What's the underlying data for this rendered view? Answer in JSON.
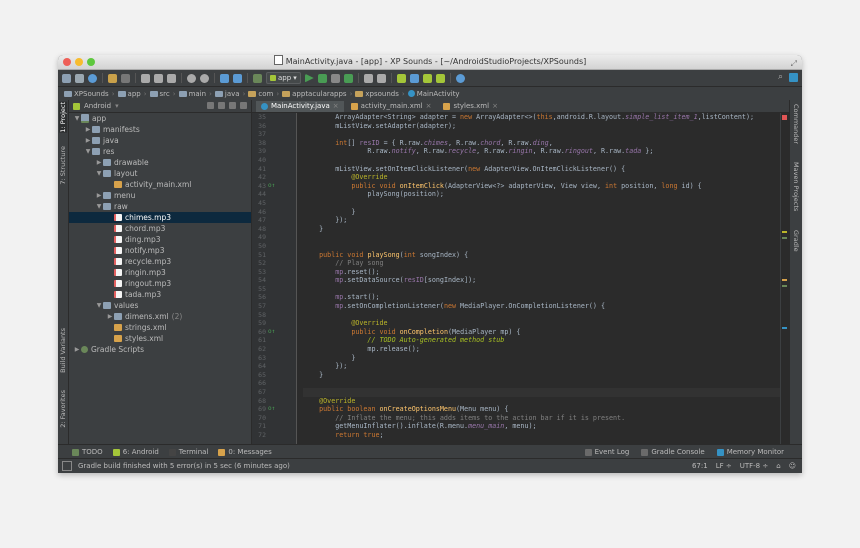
{
  "window": {
    "title": "MainActivity.java - [app] - XP Sounds - [~/AndroidStudioProjects/XPSounds]"
  },
  "toolbar": {
    "run_config": "app"
  },
  "breadcrumbs": [
    {
      "label": "XPSounds",
      "icon": "project-icon"
    },
    {
      "label": "app",
      "icon": "module-icon"
    },
    {
      "label": "src",
      "icon": "folder-icon"
    },
    {
      "label": "main",
      "icon": "folder-icon"
    },
    {
      "label": "java",
      "icon": "folder-icon"
    },
    {
      "label": "com",
      "icon": "package-icon"
    },
    {
      "label": "apptacularapps",
      "icon": "package-icon"
    },
    {
      "label": "xpsounds",
      "icon": "package-icon"
    },
    {
      "label": "MainActivity",
      "icon": "class-icon"
    }
  ],
  "left_tool_tabs": [
    "1: Project",
    "7: Structure",
    "Build Variants",
    "2: Favorites"
  ],
  "right_tool_tabs": [
    "Commander",
    "Maven Projects",
    "Gradle"
  ],
  "project": {
    "view_selector": "Android",
    "tree": [
      {
        "label": "app",
        "depth": 0,
        "icon": "module",
        "open": true
      },
      {
        "label": "manifests",
        "depth": 1,
        "icon": "folder",
        "open": false
      },
      {
        "label": "java",
        "depth": 1,
        "icon": "folder",
        "open": false
      },
      {
        "label": "res",
        "depth": 1,
        "icon": "folder",
        "open": true
      },
      {
        "label": "drawable",
        "depth": 2,
        "icon": "folder",
        "open": false
      },
      {
        "label": "layout",
        "depth": 2,
        "icon": "folder",
        "open": true
      },
      {
        "label": "activity_main.xml",
        "depth": 3,
        "icon": "xml"
      },
      {
        "label": "menu",
        "depth": 2,
        "icon": "folder",
        "open": false
      },
      {
        "label": "raw",
        "depth": 2,
        "icon": "folder",
        "open": true
      },
      {
        "label": "chimes.mp3",
        "depth": 3,
        "icon": "mp3",
        "selected": true
      },
      {
        "label": "chord.mp3",
        "depth": 3,
        "icon": "mp3"
      },
      {
        "label": "ding.mp3",
        "depth": 3,
        "icon": "mp3"
      },
      {
        "label": "notify.mp3",
        "depth": 3,
        "icon": "mp3"
      },
      {
        "label": "recycle.mp3",
        "depth": 3,
        "icon": "mp3"
      },
      {
        "label": "ringin.mp3",
        "depth": 3,
        "icon": "mp3"
      },
      {
        "label": "ringout.mp3",
        "depth": 3,
        "icon": "mp3"
      },
      {
        "label": "tada.mp3",
        "depth": 3,
        "icon": "mp3"
      },
      {
        "label": "values",
        "depth": 2,
        "icon": "folder",
        "open": true
      },
      {
        "label": "dimens.xml",
        "depth": 3,
        "icon": "folder",
        "open": false,
        "extra": "(2)"
      },
      {
        "label": "strings.xml",
        "depth": 3,
        "icon": "xml"
      },
      {
        "label": "styles.xml",
        "depth": 3,
        "icon": "xml"
      },
      {
        "label": "Gradle Scripts",
        "depth": 0,
        "icon": "gradle",
        "open": false
      }
    ]
  },
  "editor_tabs": [
    {
      "label": "MainActivity.java",
      "icon": "java",
      "active": true
    },
    {
      "label": "activity_main.xml",
      "icon": "xml",
      "active": false
    },
    {
      "label": "styles.xml",
      "icon": "xml",
      "active": false
    }
  ],
  "code_lines": [
    {
      "n": "35",
      "mark": "",
      "html": "        ArrayAdapter&lt;String&gt; adapter = <span class=\"kw\">new</span> ArrayAdapter&lt;&gt;(<span class=\"kw\">this</span>,android.R.layout.<span class=\"fld\">simple_list_item_1</span>,listContent);"
    },
    {
      "n": "36",
      "mark": "",
      "html": "        mListView.setAdapter(adapter);"
    },
    {
      "n": "37",
      "mark": "",
      "html": ""
    },
    {
      "n": "38",
      "mark": "",
      "html": "        <span class=\"kw\">int</span>[] <span class=\"var\">resID</span> = { R.raw.<span class=\"fld\">chimes</span>, R.raw.<span class=\"fld\">chord</span>, R.raw.<span class=\"fld\">ding</span>,"
    },
    {
      "n": "39",
      "mark": "",
      "html": "                R.raw.<span class=\"fld\">notify</span>, R.raw.<span class=\"fld\">recycle</span>, R.raw.<span class=\"fld\">ringin</span>, R.raw.<span class=\"fld\">ringout</span>, R.raw.<span class=\"fld\">tada</span> };"
    },
    {
      "n": "40",
      "mark": "",
      "html": ""
    },
    {
      "n": "41",
      "mark": "",
      "html": "        mListView.setOnItemClickListener(<span class=\"kw\">new</span> AdapterView.OnItemClickListener() {"
    },
    {
      "n": "42",
      "mark": "",
      "html": "            <span class=\"ann\">@Override</span>"
    },
    {
      "n": "43",
      "mark": "o↑",
      "html": "            <span class=\"kw\">public void</span> <span class=\"fn\">onItemClick</span>(AdapterView&lt;?&gt; adapterView, View view, <span class=\"kw\">int</span> position, <span class=\"kw\">long</span> id) {"
    },
    {
      "n": "44",
      "mark": "",
      "html": "                playSong(position);"
    },
    {
      "n": "45",
      "mark": "",
      "html": ""
    },
    {
      "n": "46",
      "mark": "",
      "html": "            }"
    },
    {
      "n": "47",
      "mark": "",
      "html": "        });"
    },
    {
      "n": "48",
      "mark": "",
      "html": "    }"
    },
    {
      "n": "49",
      "mark": "",
      "html": ""
    },
    {
      "n": "50",
      "mark": "",
      "html": ""
    },
    {
      "n": "51",
      "mark": "",
      "html": "    <span class=\"kw\">public void</span> <span class=\"fn\">playSong</span>(<span class=\"kw\">int</span> songIndex) {"
    },
    {
      "n": "52",
      "mark": "",
      "html": "        <span class=\"cmt\">// Play song</span>"
    },
    {
      "n": "53",
      "mark": "",
      "html": "        <span class=\"var\">mp</span>.reset();"
    },
    {
      "n": "54",
      "mark": "",
      "html": "        <span class=\"var\">mp</span>.setDataSource(<span class=\"var\">resID</span>[songIndex]);"
    },
    {
      "n": "55",
      "mark": "",
      "html": ""
    },
    {
      "n": "56",
      "mark": "",
      "html": "        <span class=\"var\">mp</span>.start();"
    },
    {
      "n": "57",
      "mark": "",
      "html": "        <span class=\"var\">mp</span>.setOnCompletionListener(<span class=\"kw\">new</span> MediaPlayer.OnCompletionListener() {"
    },
    {
      "n": "58",
      "mark": "",
      "html": ""
    },
    {
      "n": "59",
      "mark": "",
      "html": "            <span class=\"ann\">@Override</span>"
    },
    {
      "n": "60",
      "mark": "o↑",
      "html": "            <span class=\"kw\">public void</span> <span class=\"fn\">onCompletion</span>(MediaPlayer mp) {"
    },
    {
      "n": "61",
      "mark": "",
      "html": "                <span class=\"todo\">// TODO Auto-generated method stub</span>"
    },
    {
      "n": "62",
      "mark": "",
      "html": "                mp.release();"
    },
    {
      "n": "63",
      "mark": "",
      "html": "            }"
    },
    {
      "n": "64",
      "mark": "",
      "html": "        });"
    },
    {
      "n": "65",
      "mark": "",
      "html": "    }"
    },
    {
      "n": "66",
      "mark": "",
      "html": ""
    },
    {
      "n": "67",
      "mark": "",
      "html": "",
      "hl": true
    },
    {
      "n": "68",
      "mark": "",
      "html": "    <span class=\"ann\">@Override</span>"
    },
    {
      "n": "69",
      "mark": "o↑",
      "html": "    <span class=\"kw\">public boolean</span> <span class=\"fn\">onCreateOptionsMenu</span>(Menu menu) {"
    },
    {
      "n": "70",
      "mark": "",
      "html": "        <span class=\"cmt\">// Inflate the menu; this adds items to the action bar if it is present.</span>"
    },
    {
      "n": "71",
      "mark": "",
      "html": "        getMenuInflater().inflate(R.menu.<span class=\"fld\">menu_main</span>, menu);"
    },
    {
      "n": "72",
      "mark": "",
      "html": "        <span class=\"kw\">return true</span>;"
    }
  ],
  "tool_windows": {
    "left": [
      {
        "label": "TODO",
        "icon": "todo-icon",
        "color": "#6a8759"
      },
      {
        "label": "6: Android",
        "icon": "android-icon",
        "color": "#a4c639"
      },
      {
        "label": "Terminal",
        "icon": "terminal-icon",
        "color": "#444444"
      },
      {
        "label": "0: Messages",
        "icon": "messages-icon",
        "color": "#d7a24b"
      }
    ],
    "right": [
      {
        "label": "Event Log",
        "icon": "event-log-icon",
        "color": "#6a6a6a"
      },
      {
        "label": "Gradle Console",
        "icon": "gradle-console-icon",
        "color": "#6a6a6a"
      },
      {
        "label": "Memory Monitor",
        "icon": "memory-monitor-icon",
        "color": "#3592c4"
      }
    ]
  },
  "status": {
    "message": "Gradle build finished with 5 error(s) in 5 sec (6 minutes ago)",
    "position": "67:1",
    "line_separator": "LF ÷",
    "encoding": "UTF-8 ÷"
  },
  "colors": {
    "accent": "#3592c4",
    "editor_bg": "#2b2b2b",
    "panel_bg": "#3c3f41",
    "selection": "#0d293e"
  }
}
